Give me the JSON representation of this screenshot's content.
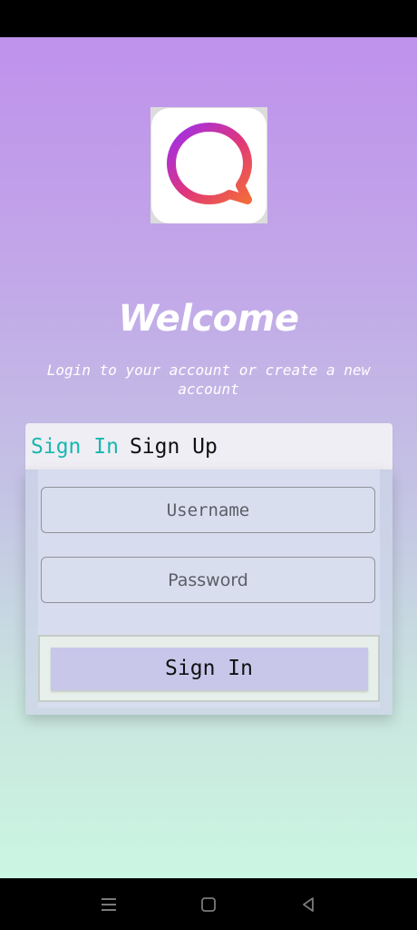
{
  "header": {
    "title": "Welcome",
    "subtitle": "Login to your account or create a new account"
  },
  "logo": {
    "icon": "chat-bubble-icon",
    "colors": [
      "#9b2ff0",
      "#e0367a",
      "#f26a3a"
    ]
  },
  "tabs": [
    {
      "label": "Sign In",
      "active": true
    },
    {
      "label": "Sign Up",
      "active": false
    }
  ],
  "form": {
    "username_placeholder": "Username",
    "password_placeholder": "Password",
    "submit_label": "Sign In"
  },
  "colors": {
    "accent": "#16b8b1",
    "gradient_top": "#bf91ec",
    "gradient_bottom": "#cbf6e2",
    "button": "#c8c7ea"
  },
  "navigation": {
    "icons": [
      "menu-icon",
      "home-icon",
      "back-icon"
    ]
  }
}
